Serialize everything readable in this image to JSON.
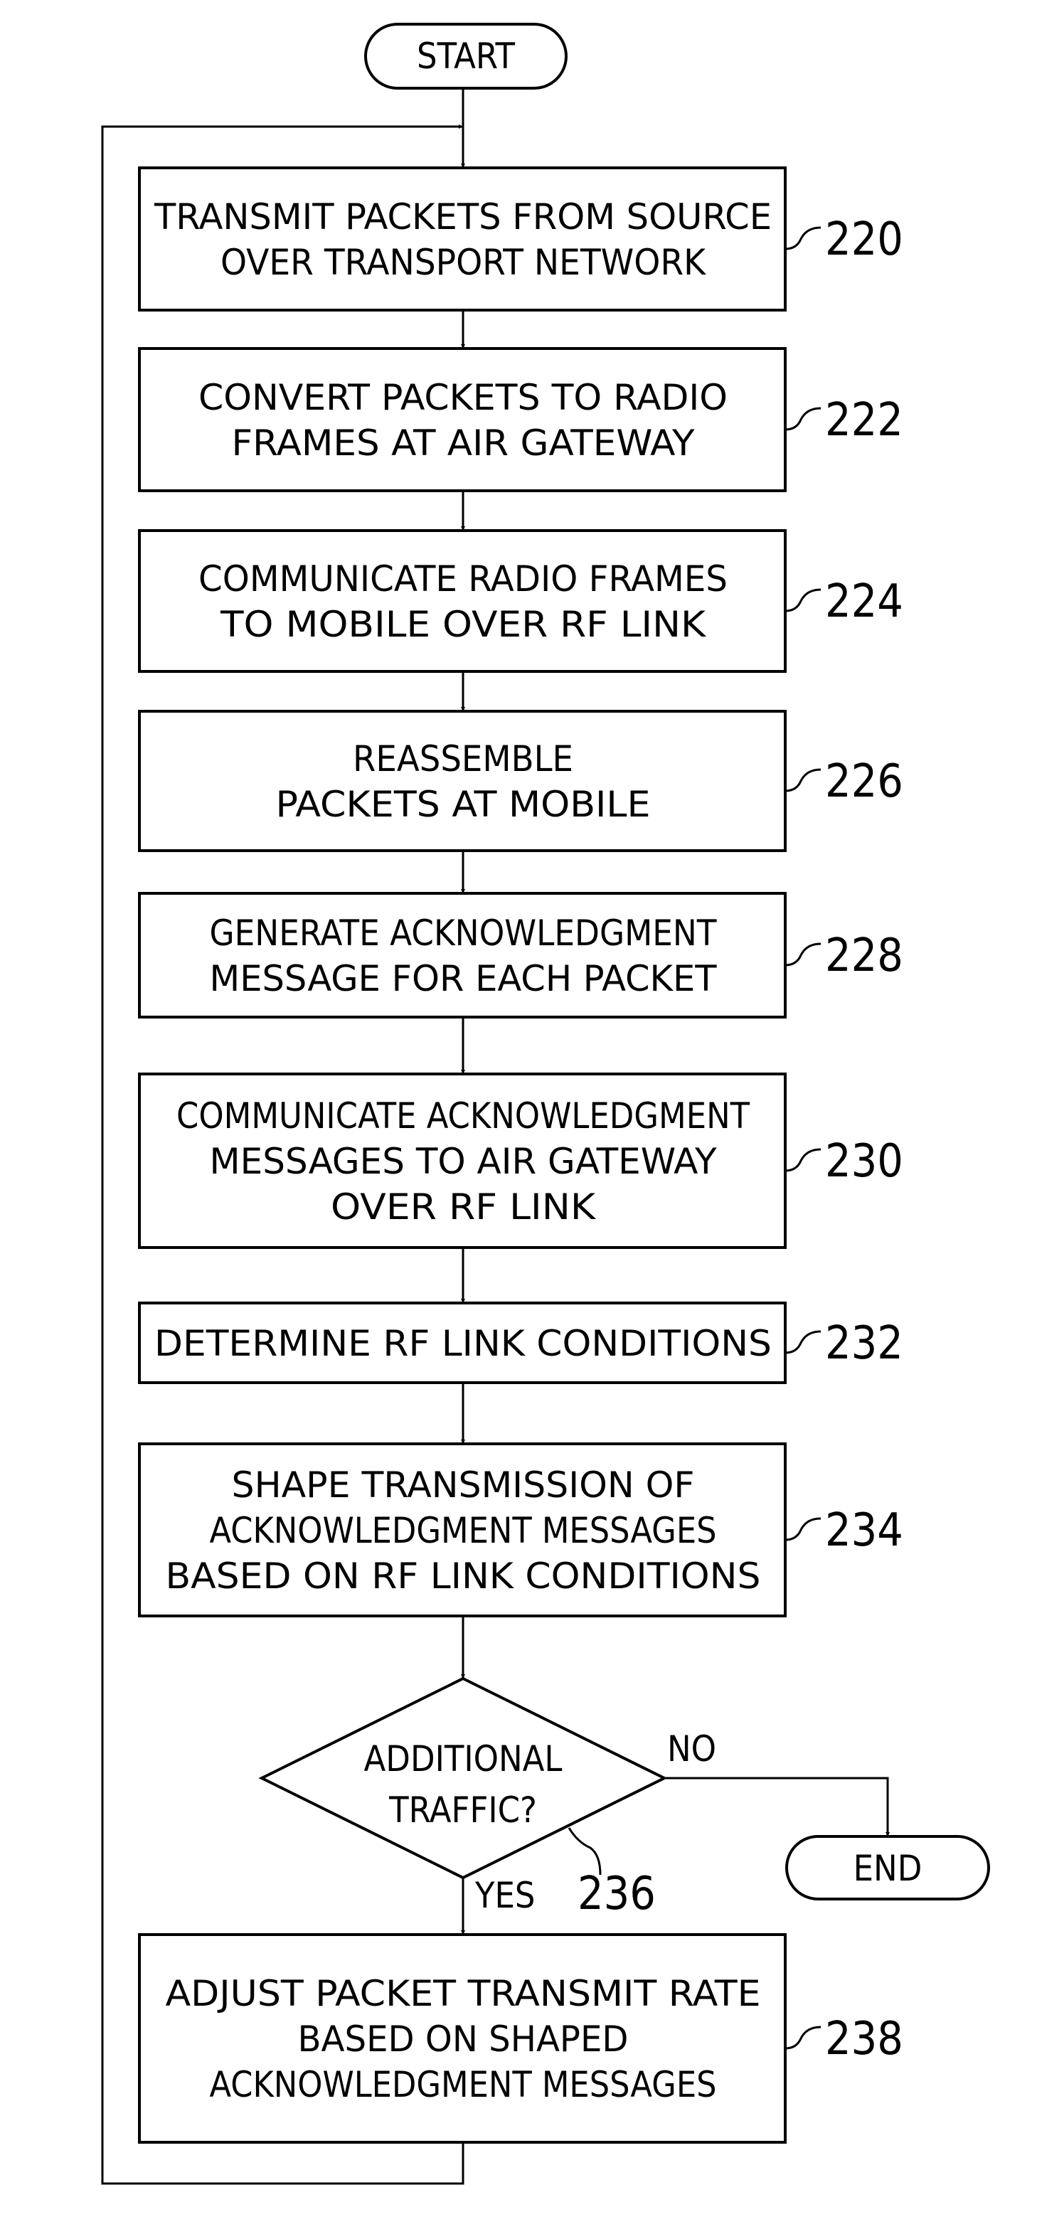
{
  "flowchart": {
    "start_label": "START",
    "end_label": "END",
    "steps": [
      {
        "ref": "220",
        "lines": [
          "TRANSMIT PACKETS FROM SOURCE",
          "OVER TRANSPORT NETWORK"
        ]
      },
      {
        "ref": "222",
        "lines": [
          "CONVERT PACKETS TO RADIO",
          "FRAMES AT AIR GATEWAY"
        ]
      },
      {
        "ref": "224",
        "lines": [
          "COMMUNICATE RADIO FRAMES",
          "TO MOBILE OVER RF LINK"
        ]
      },
      {
        "ref": "226",
        "lines": [
          "REASSEMBLE",
          "PACKETS AT MOBILE"
        ]
      },
      {
        "ref": "228",
        "lines": [
          "GENERATE ACKNOWLEDGMENT",
          "MESSAGE FOR EACH PACKET"
        ]
      },
      {
        "ref": "230",
        "lines": [
          "COMMUNICATE ACKNOWLEDGMENT",
          "MESSAGES TO AIR GATEWAY",
          "OVER RF LINK"
        ]
      },
      {
        "ref": "232",
        "lines": [
          "DETERMINE RF LINK CONDITIONS"
        ]
      },
      {
        "ref": "234",
        "lines": [
          "SHAPE TRANSMISSION OF",
          "ACKNOWLEDGMENT MESSAGES",
          "BASED ON RF LINK CONDITIONS"
        ]
      }
    ],
    "decision": {
      "ref": "236",
      "lines": [
        "ADDITIONAL",
        "TRAFFIC?"
      ],
      "yes_label": "YES",
      "no_label": "NO"
    },
    "final_step": {
      "ref": "238",
      "lines": [
        "ADJUST PACKET TRANSMIT RATE",
        "BASED ON SHAPED",
        "ACKNOWLEDGMENT MESSAGES"
      ]
    }
  }
}
